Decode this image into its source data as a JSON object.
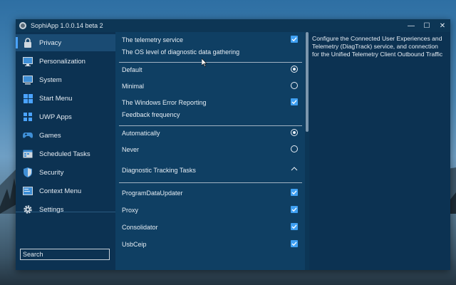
{
  "window": {
    "title": "SophiApp 1.0.0.14 beta 2"
  },
  "controls": {
    "minimize": "—",
    "maximize": "☐",
    "close": "✕"
  },
  "sidebar": {
    "items": [
      {
        "label": "Privacy",
        "icon": "privacy-icon",
        "active": true
      },
      {
        "label": "Personalization",
        "icon": "personalization-icon"
      },
      {
        "label": "System",
        "icon": "system-icon"
      },
      {
        "label": "Start Menu",
        "icon": "start-menu-icon"
      },
      {
        "label": "UWP Apps",
        "icon": "uwp-apps-icon"
      },
      {
        "label": "Games",
        "icon": "games-icon"
      },
      {
        "label": "Scheduled Tasks",
        "icon": "scheduled-tasks-icon"
      },
      {
        "label": "Security",
        "icon": "security-icon"
      },
      {
        "label": "Context Menu",
        "icon": "context-menu-icon"
      },
      {
        "label": "Settings",
        "icon": "settings-icon"
      }
    ],
    "search_placeholder": "Search"
  },
  "main": {
    "telemetry_service": {
      "label": "The telemetry service",
      "checked": true
    },
    "diagnostic_level_header": "The OS level of diagnostic data gathering",
    "level_default": {
      "label": "Default",
      "selected": true
    },
    "level_minimal": {
      "label": "Minimal",
      "selected": false
    },
    "error_reporting": {
      "label": "The Windows Error Reporting",
      "checked": true
    },
    "feedback_header": "Feedback frequency",
    "freq_auto": {
      "label": "Automatically",
      "selected": true
    },
    "freq_never": {
      "label": "Never",
      "selected": false
    },
    "tracking_header": "Diagnostic Tracking Tasks",
    "tasks": [
      {
        "label": "ProgramDataUpdater",
        "checked": true
      },
      {
        "label": "Proxy",
        "checked": true
      },
      {
        "label": "Consolidator",
        "checked": true
      },
      {
        "label": "UsbCeip",
        "checked": true
      }
    ]
  },
  "description": "Configure the Connected User Experiences and Telemetry (DiagTrack) service, and connection for the Unified Telemetry Client Outbound Traffic",
  "colors": {
    "accent": "#3fa0f2",
    "window_bg": "#0e3a5c",
    "sidebar_bg": "#0c3252"
  }
}
